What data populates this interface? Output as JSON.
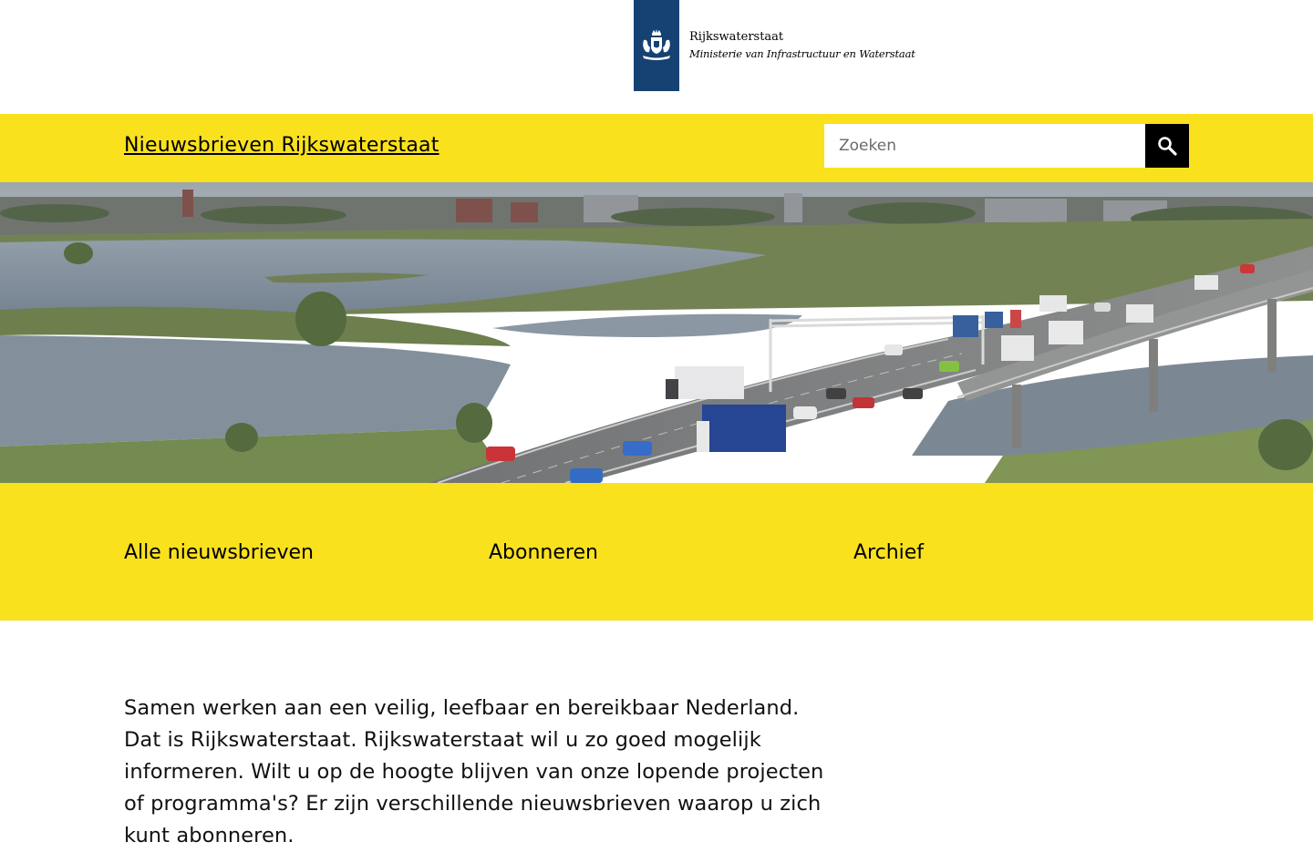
{
  "logo": {
    "organization": "Rijkswaterstaat",
    "ministry": "Ministerie van Infrastructuur en Waterstaat",
    "ribbon_color": "#154273"
  },
  "site_bar": {
    "title": "Nieuwsbrieven Rijkswaterstaat",
    "accent_color": "#f9e11e"
  },
  "search": {
    "placeholder": "Zoeken",
    "value": "",
    "icon": "search-icon"
  },
  "hero": {
    "icon": "hero-photo-highway-bridge-river"
  },
  "nav": {
    "items": [
      {
        "label": "Alle nieuwsbrieven"
      },
      {
        "label": "Abonneren"
      },
      {
        "label": "Archief"
      }
    ]
  },
  "intro": {
    "text": "Samen werken aan een veilig, leefbaar en bereikbaar Nederland. Dat is Rijkswaterstaat. Rijkswaterstaat wil u zo goed mogelijk informeren. Wilt u op de hoogte blijven van onze lopende projecten of programma's? Er zijn verschillende nieuwsbrieven waarop u zich kunt abonneren."
  }
}
